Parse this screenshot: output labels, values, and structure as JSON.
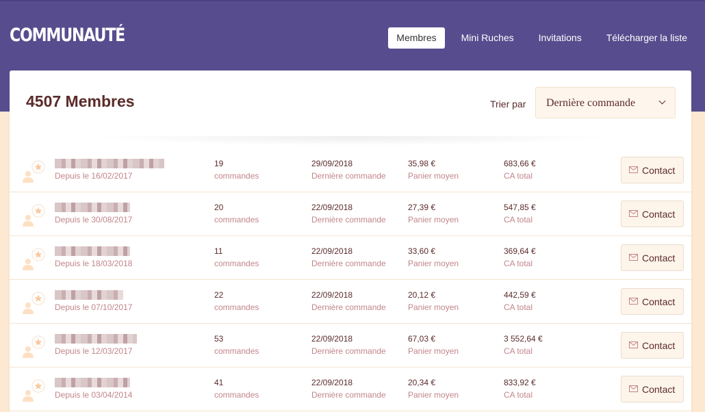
{
  "header": {
    "logo": "COMMUNAUTÉ",
    "nav": [
      {
        "label": "Membres",
        "active": true
      },
      {
        "label": "Mini Ruches",
        "active": false
      },
      {
        "label": "Invitations",
        "active": false
      },
      {
        "label": "Télécharger la liste",
        "active": false
      }
    ]
  },
  "main": {
    "title": "4507 Membres",
    "sort_label": "Trier par",
    "sort_value": "Dernière commande",
    "contact_label": "Contact",
    "members": [
      {
        "since": "Depuis le 16/02/2017",
        "orders": "19",
        "orders_label": "commandes",
        "last": "29/09/2018",
        "last_label": "Dernière commande",
        "avg": "35,98 €",
        "avg_label": "Panier moyen",
        "ca": "683,66 €",
        "ca_label": "CA total"
      },
      {
        "since": "Depuis le 30/08/2017",
        "orders": "20",
        "orders_label": "commandes",
        "last": "22/09/2018",
        "last_label": "Dernière commande",
        "avg": "27,39 €",
        "avg_label": "Panier moyen",
        "ca": "547,85 €",
        "ca_label": "CA total"
      },
      {
        "since": "Depuis le 18/03/2018",
        "orders": "11",
        "orders_label": "commandes",
        "last": "22/09/2018",
        "last_label": "Dernière commande",
        "avg": "33,60 €",
        "avg_label": "Panier moyen",
        "ca": "369,64 €",
        "ca_label": "CA total"
      },
      {
        "since": "Depuis le 07/10/2017",
        "orders": "22",
        "orders_label": "commandes",
        "last": "22/09/2018",
        "last_label": "Dernière commande",
        "avg": "20,12 €",
        "avg_label": "Panier moyen",
        "ca": "442,59 €",
        "ca_label": "CA total"
      },
      {
        "since": "Depuis le 12/03/2017",
        "orders": "53",
        "orders_label": "commandes",
        "last": "22/09/2018",
        "last_label": "Dernière commande",
        "avg": "67,03 €",
        "avg_label": "Panier moyen",
        "ca": "3 552,64 €",
        "ca_label": "CA total"
      },
      {
        "since": "Depuis le 03/04/2014",
        "orders": "41",
        "orders_label": "commandes",
        "last": "22/09/2018",
        "last_label": "Dernière commande",
        "avg": "20,34 €",
        "avg_label": "Panier moyen",
        "ca": "833,92 €",
        "ca_label": "CA total"
      }
    ]
  },
  "icons": {
    "avatar": "user-star-icon",
    "contact": "envelope-icon",
    "sort": "chevron-down-icon"
  },
  "colors": {
    "header": "#574d8e",
    "background": "#fde9d2",
    "text": "#5b2a2a",
    "muted": "#c2858a"
  }
}
